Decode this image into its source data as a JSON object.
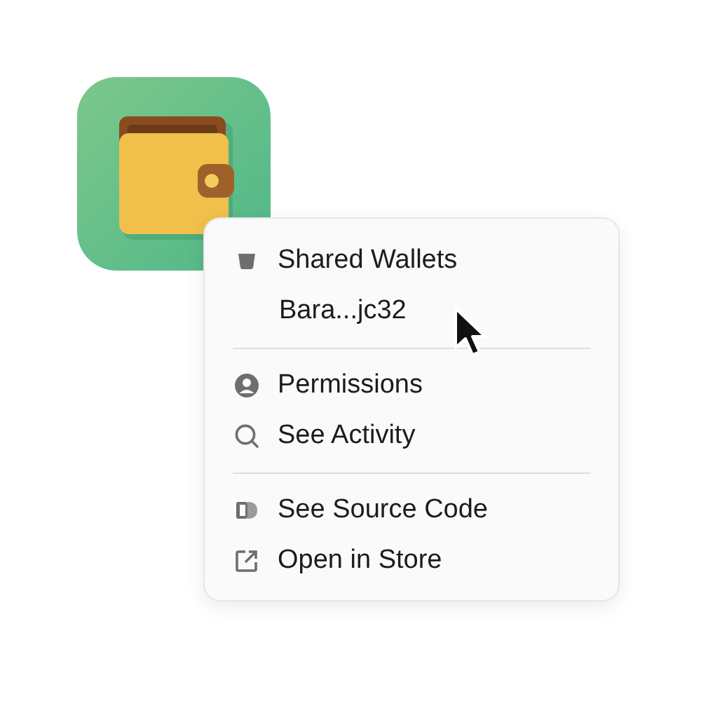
{
  "menu": {
    "sections": [
      {
        "items": [
          {
            "kind": "icon",
            "label": "Shared Wallets"
          },
          {
            "kind": "sub",
            "label": "Bara...jc32"
          }
        ]
      },
      {
        "items": [
          {
            "kind": "icon",
            "label": "Permissions"
          },
          {
            "kind": "icon",
            "label": "See Activity"
          }
        ]
      },
      {
        "items": [
          {
            "kind": "icon",
            "label": "See Source Code"
          },
          {
            "kind": "icon",
            "label": "Open in Store"
          }
        ]
      }
    ]
  }
}
